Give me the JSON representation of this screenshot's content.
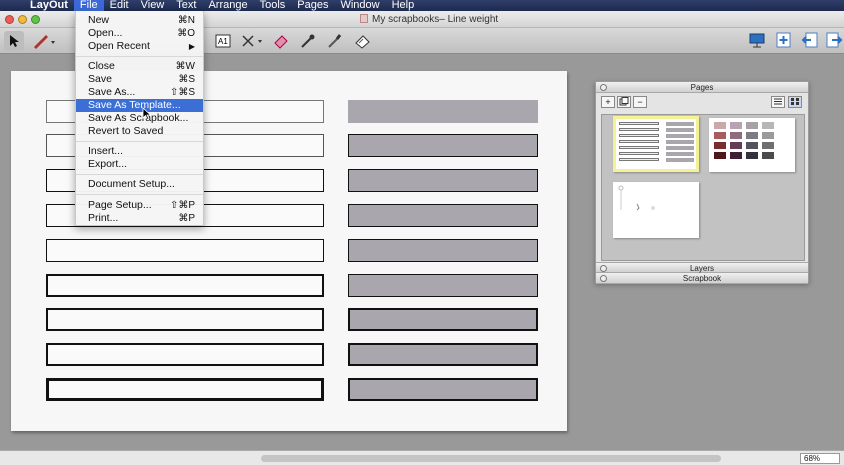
{
  "menubar": {
    "app": "LayOut",
    "items": [
      "File",
      "Edit",
      "View",
      "Text",
      "Arrange",
      "Tools",
      "Pages",
      "Window",
      "Help"
    ],
    "active": "File"
  },
  "window": {
    "title": "My scrapbooks– Line weight"
  },
  "file_menu": {
    "items": [
      {
        "label": "New",
        "shortcut": "⌘N"
      },
      {
        "label": "Open...",
        "shortcut": "⌘O"
      },
      {
        "label": "Open Recent",
        "shortcut": "▶"
      },
      {
        "label": "Close",
        "shortcut": "⌘W"
      },
      {
        "label": "Save",
        "shortcut": "⌘S"
      },
      {
        "label": "Save As...",
        "shortcut": "⇧⌘S"
      },
      {
        "label": "Save As Template...",
        "shortcut": ""
      },
      {
        "label": "Save As Scrapbook...",
        "shortcut": ""
      },
      {
        "label": "Revert to Saved",
        "shortcut": ""
      },
      {
        "label": "Insert...",
        "shortcut": ""
      },
      {
        "label": "Export...",
        "shortcut": ""
      },
      {
        "label": "Document Setup...",
        "shortcut": ""
      },
      {
        "label": "Page Setup...",
        "shortcut": "⇧⌘P"
      },
      {
        "label": "Print...",
        "shortcut": "⌘P"
      }
    ],
    "highlighted": "Save As Template..."
  },
  "toolbar": {
    "icons": [
      "arrow-select-icon",
      "pencil-icon",
      "text-icon",
      "dimension-icon",
      "eraser-icon",
      "eyedropper-icon",
      "paint-bucket-icon",
      "style-icon"
    ],
    "right_icons": [
      "presentation-icon",
      "add-page-icon",
      "previous-page-icon",
      "next-page-icon"
    ]
  },
  "pages_palette": {
    "title": "Pages",
    "buttons": [
      "+",
      "−"
    ],
    "sections": [
      "Layers",
      "Scrapbook"
    ]
  },
  "zoom": "68%",
  "colors": {
    "accent": "#3c6fd6",
    "grey_box": "#a9a6ad",
    "canvas": "#999999"
  }
}
